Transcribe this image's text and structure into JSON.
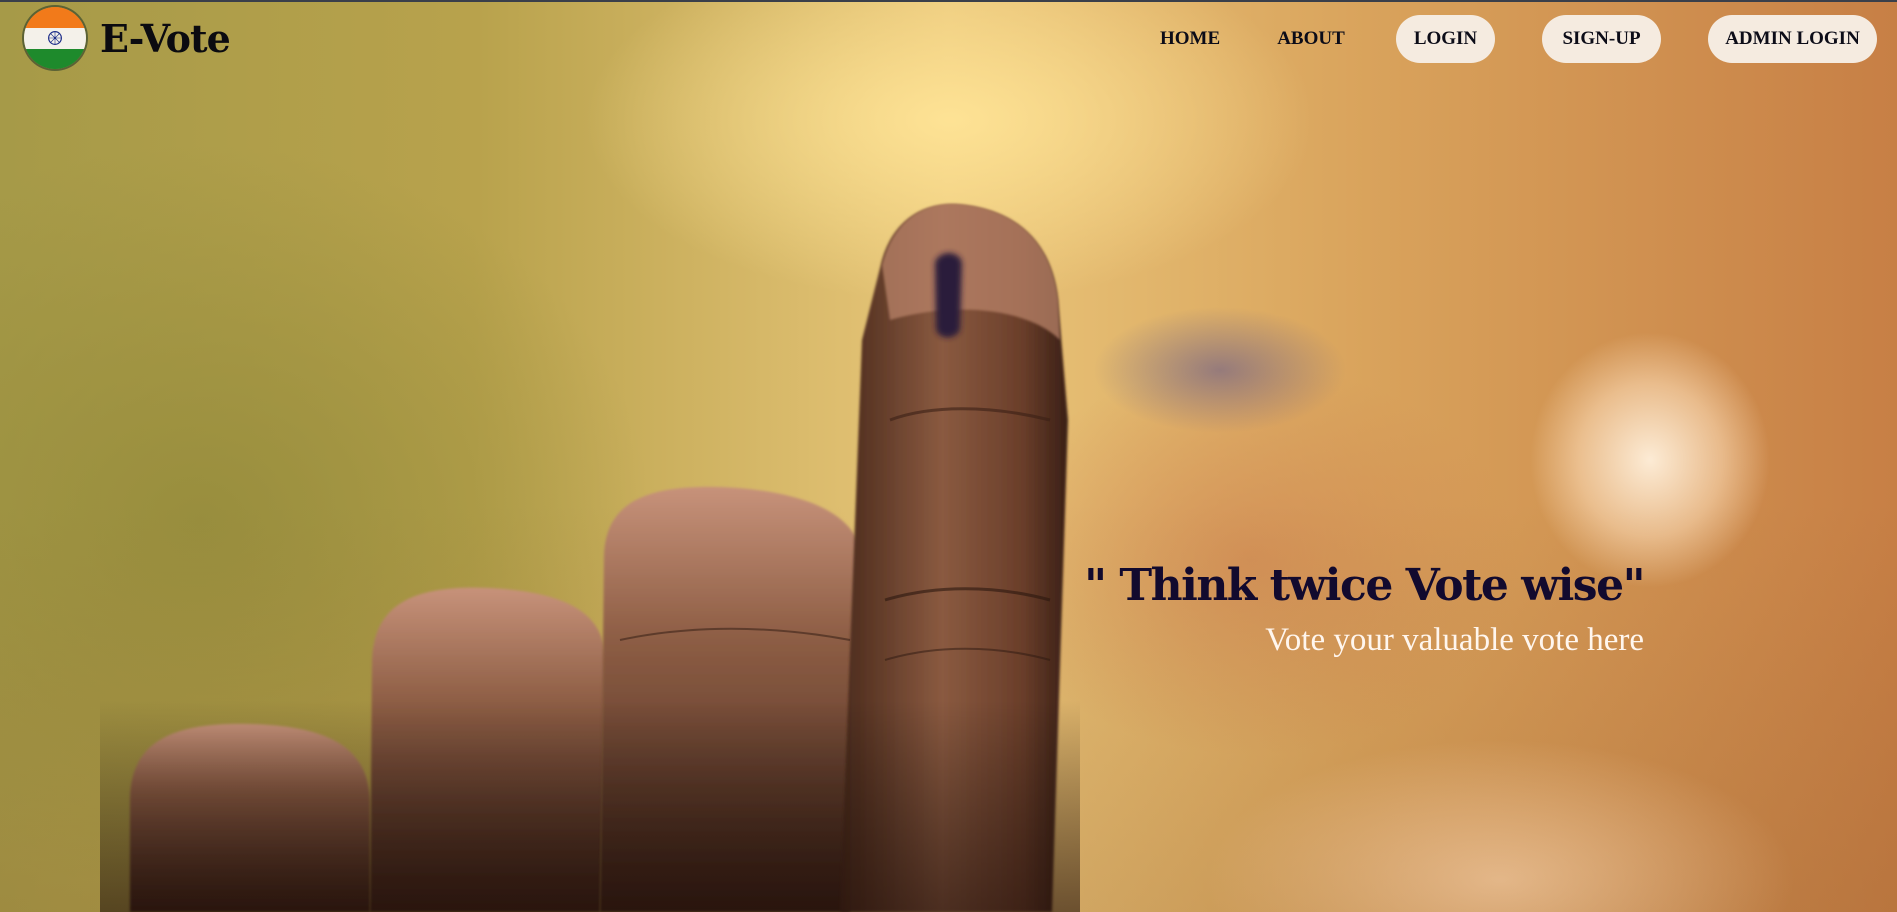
{
  "brand": {
    "name": "E-Vote",
    "logo_icon": "india-flag-icon",
    "colors": {
      "saffron": "#f27a1a",
      "white": "#f4f1ea",
      "green": "#1e8a2c",
      "chakra": "#1f2f8a"
    }
  },
  "nav": {
    "home": "HOME",
    "about": "ABOUT",
    "login": "LOGIN",
    "signup": "SIGN-UP",
    "admin_login": "ADMIN LOGIN"
  },
  "hero": {
    "background": "hand-with-inked-finger-image",
    "quote": "\" Think twice Vote wise\"",
    "subtitle": "Vote your valuable vote here"
  },
  "colors": {
    "nav_pill": "#f5ebe0",
    "quote_text": "#120a2e",
    "subtitle_text": "#fff6ee"
  }
}
